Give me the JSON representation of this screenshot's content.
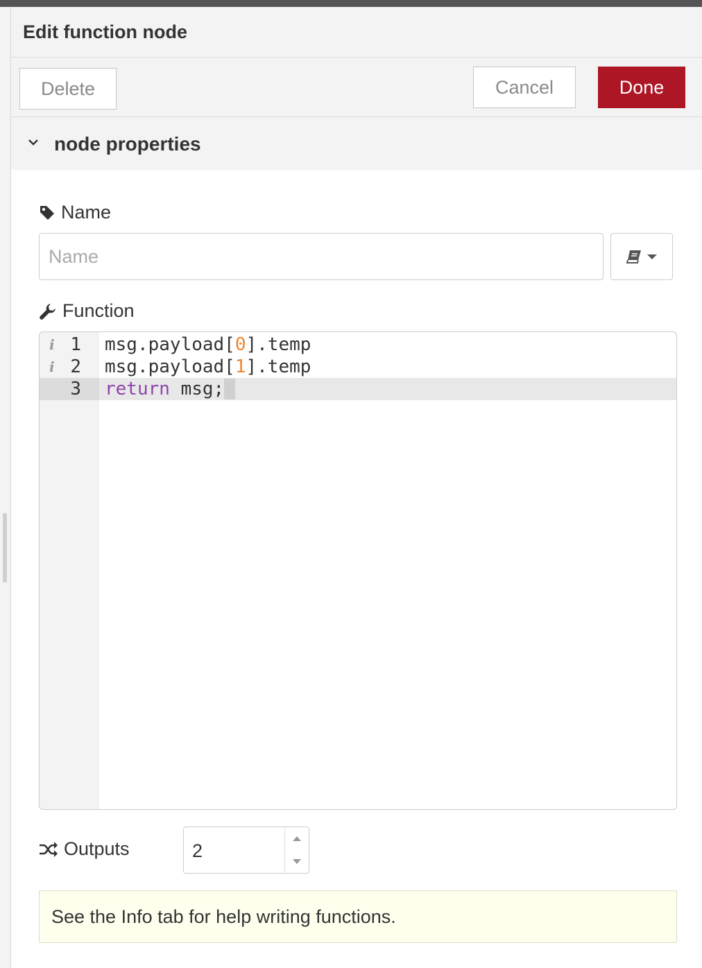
{
  "header": {
    "title": "Edit function node"
  },
  "toolbar": {
    "delete_label": "Delete",
    "cancel_label": "Cancel",
    "done_label": "Done"
  },
  "section": {
    "title": "node properties",
    "icon": "chevron-down-icon"
  },
  "name_field": {
    "label": "Name",
    "placeholder": "Name",
    "value": "",
    "icon": "tag-icon",
    "library_icon": "book-icon",
    "library_dropdown_icon": "caret-down-icon"
  },
  "function_field": {
    "label": "Function",
    "icon": "wrench-icon",
    "lines": [
      {
        "number": "1",
        "info": "i",
        "text": "msg.payload[0].temp"
      },
      {
        "number": "2",
        "info": "i",
        "text": "msg.payload[1].temp"
      },
      {
        "number": "3",
        "info": "",
        "text": "return msg;"
      }
    ]
  },
  "outputs_field": {
    "label": "Outputs",
    "value": "2",
    "icon": "shuffle-icon"
  },
  "tip": {
    "text": "See the Info tab for help writing functions."
  },
  "colors": {
    "accent": "#ad1625",
    "tip_background": "#ffffee",
    "panel_background": "#f3f3f3",
    "number_literal": "#f0852e",
    "keyword": "#8e44ad"
  }
}
